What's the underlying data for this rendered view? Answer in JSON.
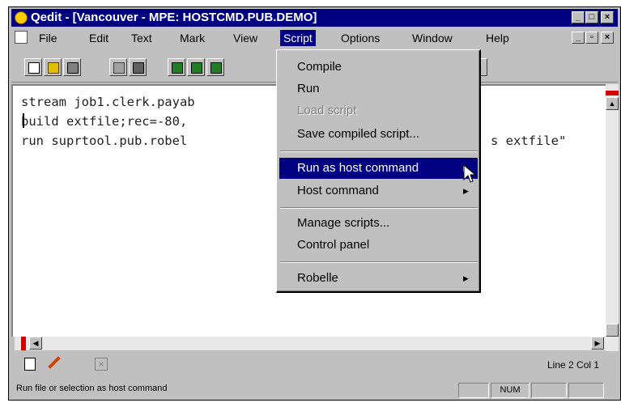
{
  "window": {
    "title": "Qedit - [Vancouver - MPE: HOSTCMD.PUB.DEMO]",
    "caption_buttons": [
      "minimize-icon",
      "maximize-icon",
      "close-icon"
    ],
    "child_buttons": [
      "minimize-icon",
      "restore-icon",
      "close-icon"
    ]
  },
  "menubar": {
    "items": [
      "File",
      "Edit",
      "Text",
      "Mark",
      "View",
      "Script",
      "Options",
      "Window",
      "Help"
    ],
    "active": "Script"
  },
  "toolbar": {
    "buttons": [
      "new-icon",
      "open-icon",
      "save-icon",
      "copy-icon",
      "print-icon",
      "tool1-icon",
      "tool2-icon",
      "tool3-icon"
    ]
  },
  "editor": {
    "lines": [
      "stream job1.clerk.payab",
      "build extfile;rec=-80,",
      "run suprtool.pub.robel"
    ],
    "line3_tail": "s extfile\""
  },
  "dropdown": {
    "items": [
      {
        "label": "Compile",
        "state": "normal"
      },
      {
        "label": "Run",
        "state": "normal"
      },
      {
        "label": "Load script",
        "state": "disabled"
      },
      {
        "label": "Save compiled script...",
        "state": "normal"
      },
      {
        "label": "Run as host command",
        "state": "highlighted",
        "submenu": true
      },
      {
        "label": "Host command",
        "state": "normal",
        "submenu": true
      },
      {
        "label": "Manage scripts...",
        "state": "normal"
      },
      {
        "label": "Control panel",
        "state": "normal"
      },
      {
        "label": "Robelle",
        "state": "normal",
        "submenu": true
      }
    ]
  },
  "lower_bar": {
    "line_info": "Line 2 Col 1"
  },
  "statusbar": {
    "text": "Run file or selection as host command",
    "indicator": "NUM"
  },
  "colors": {
    "titlebar": "#000080",
    "highlight": "#000080",
    "face": "#c0c0c0"
  }
}
